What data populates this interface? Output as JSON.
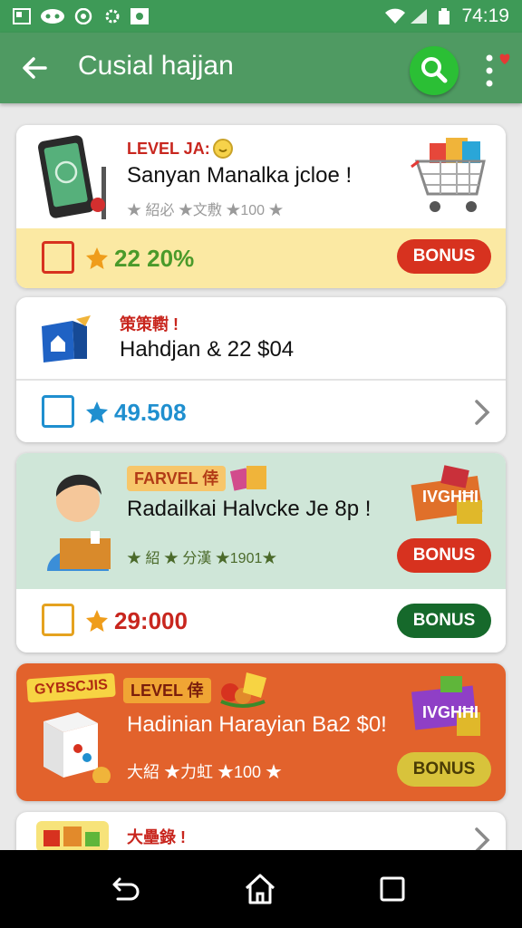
{
  "status_bar": {
    "time": "74:19"
  },
  "app_bar": {
    "title": "Cusial hajjan"
  },
  "cards": [
    {
      "level_label": "LEVEL JA:",
      "headline": "Sanyan Manalka jcloe !",
      "sub": "★ 紹必 ★文敷 ★100 ★",
      "stat": "22 20%",
      "button": "BONUS",
      "icon": "phone-icon",
      "art": "shopping-cart-icon"
    },
    {
      "level_label": "策策轛 !",
      "headline": "Hahdjan & 22 $04",
      "stat": "49.508",
      "icon": "blue-box-icon"
    },
    {
      "level_label": "FARVEL 倖",
      "headline": "Radailkai Halvcke Je 8p !",
      "sub": "★ 紹 ★ 分漢 ★1901★",
      "stat": "29:000",
      "button_top": "BONUS",
      "button_bottom": "BONUS",
      "art_label": "IVGHĦI",
      "icon": "person-with-box-icon"
    },
    {
      "banner": "GYBSCJIS",
      "level_label": "LEVEL 倖",
      "headline": "Hadinian Harayian Ba2 $0!",
      "sub": "大紹 ★力虹 ★100 ★",
      "button": "BONUS",
      "art_label": "IVGHĦI",
      "icon": "dice-box-icon"
    },
    {
      "level_label": "大壘錄 !"
    }
  ],
  "colors": {
    "app_green": "#4f9a62",
    "bonus_red": "#d7321f",
    "bonus_green": "#16692b",
    "stat_green": "#4a9a2a",
    "stat_blue": "#1f8fcf",
    "stat_red": "#c8261e"
  }
}
